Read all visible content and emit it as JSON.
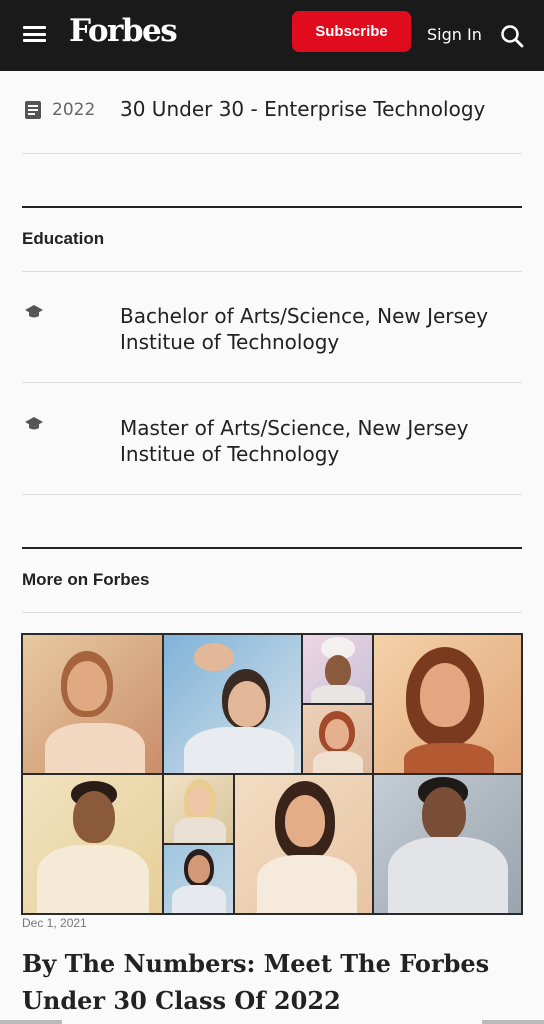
{
  "header": {
    "logo": "Forbes",
    "subscribe_label": "Subscribe",
    "signin_label": "Sign In"
  },
  "award": {
    "year": "2022",
    "title": "30 Under 30 - Enterprise Technology"
  },
  "education": {
    "heading": "Education",
    "items": [
      {
        "text": "Bachelor of Arts/Science, New Jersey Institue of Technology"
      },
      {
        "text": "Master of Arts/Science, New Jersey Institue of Technology"
      }
    ]
  },
  "more": {
    "heading": "More on Forbes",
    "article": {
      "date": "Dec 1, 2021",
      "headline": "By The Numbers: Meet The Forbes Under 30 Class Of 2022"
    }
  },
  "colors": {
    "brand_red": "#e00b1c",
    "header_bg": "#1a1a1a"
  }
}
